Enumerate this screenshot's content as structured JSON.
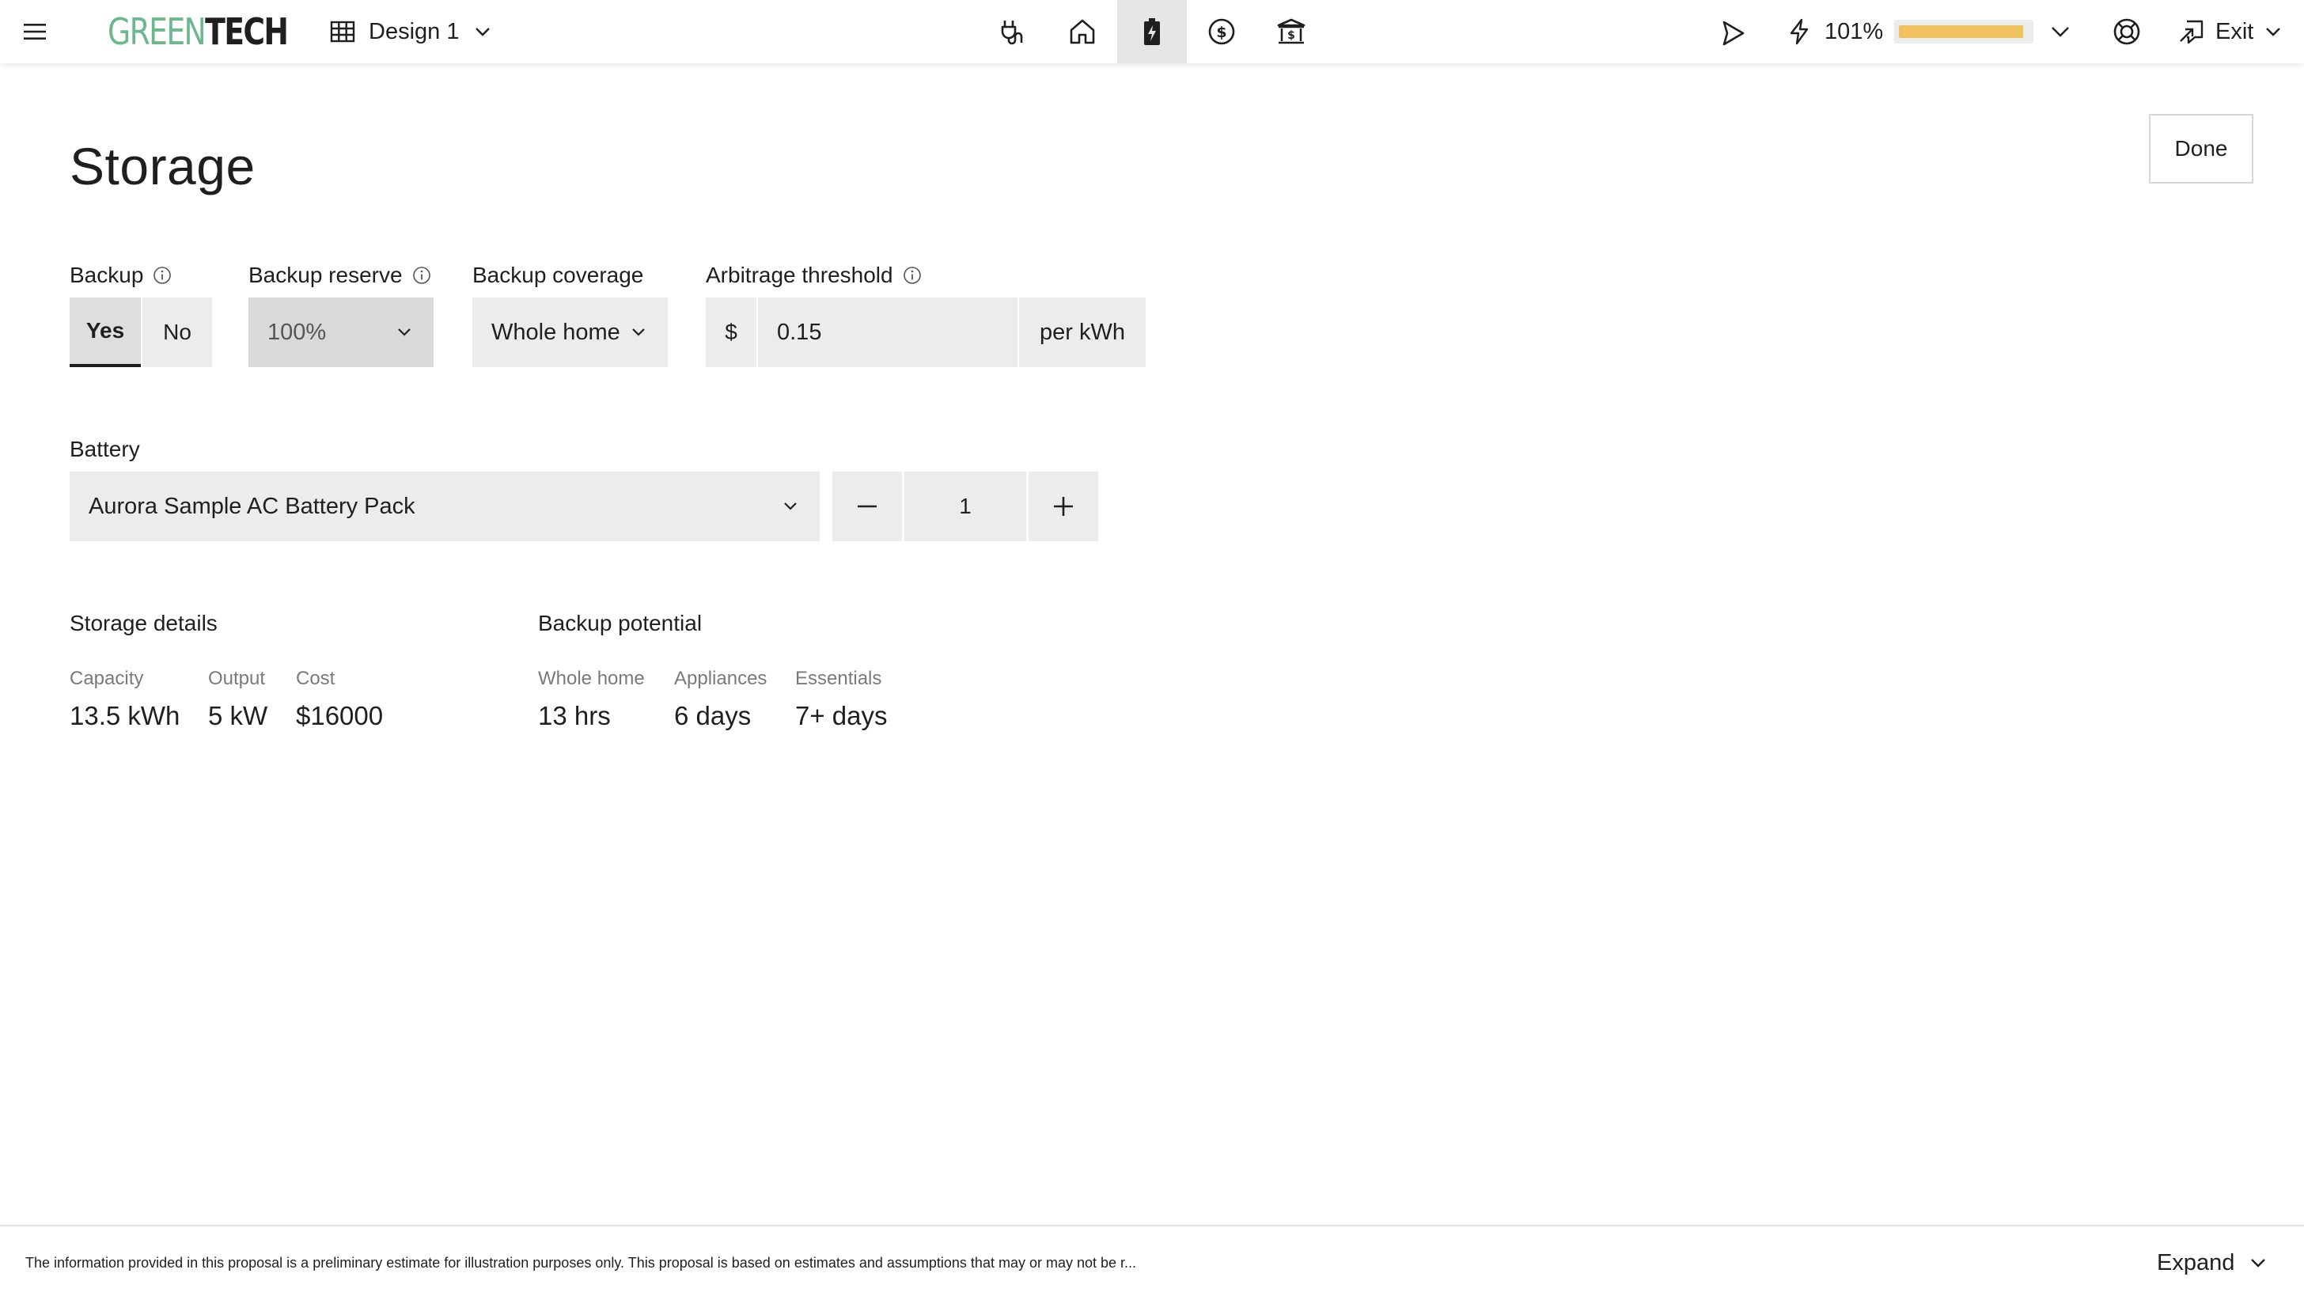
{
  "app": {
    "logo": {
      "part1": "GREEN",
      "part2": "TECH",
      "part1_color": "#6cb88d",
      "part2_color": "#1f1f1f"
    },
    "design_selector": {
      "label": "Design 1",
      "icon": "grid-icon"
    },
    "nav_tabs": [
      {
        "name": "plug-icon",
        "active": false
      },
      {
        "name": "home-icon",
        "active": false
      },
      {
        "name": "battery-icon",
        "active": true
      },
      {
        "name": "dollar-circle-icon",
        "active": false
      },
      {
        "name": "bank-icon",
        "active": false
      }
    ],
    "performance": {
      "value": "101%",
      "fill_fraction": 0.96,
      "bar_color": "#f2c15f"
    },
    "exit_label": "Exit"
  },
  "page": {
    "title": "Storage",
    "done_label": "Done"
  },
  "backup": {
    "label": "Backup",
    "options": [
      "Yes",
      "No"
    ],
    "selected": "Yes"
  },
  "backup_reserve": {
    "label": "Backup reserve",
    "value": "100%"
  },
  "backup_coverage": {
    "label": "Backup coverage",
    "value": "Whole home"
  },
  "arbitrage": {
    "label": "Arbitrage threshold",
    "prefix": "$",
    "value": "0.15",
    "suffix": "per kWh"
  },
  "battery": {
    "label": "Battery",
    "selected": "Aurora Sample AC Battery Pack",
    "quantity": "1"
  },
  "storage_details": {
    "title": "Storage details",
    "stats": [
      {
        "label": "Capacity",
        "value": "13.5 kWh"
      },
      {
        "label": "Output",
        "value": "5 kW"
      },
      {
        "label": "Cost",
        "value": "$16000"
      }
    ]
  },
  "backup_potential": {
    "title": "Backup potential",
    "stats": [
      {
        "label": "Whole home",
        "value": "13 hrs"
      },
      {
        "label": "Appliances",
        "value": "6 days"
      },
      {
        "label": "Essentials",
        "value": "7+ days"
      }
    ]
  },
  "footer": {
    "disclaimer": "The information provided in this proposal is a preliminary estimate for illustration purposes only. This proposal is based on estimates and assumptions that may or may not be r...",
    "expand_label": "Expand"
  }
}
